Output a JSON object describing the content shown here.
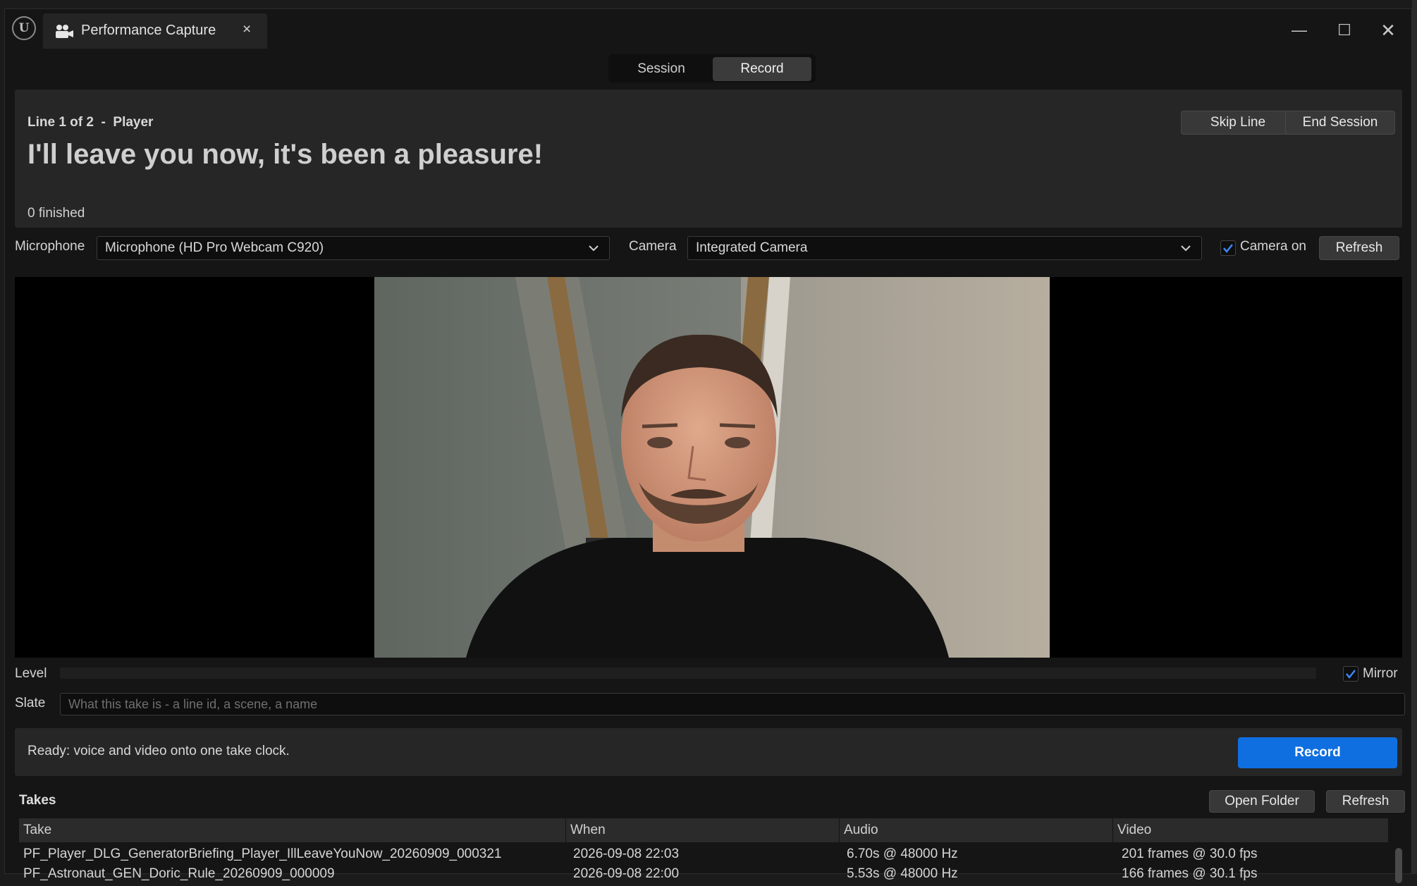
{
  "window": {
    "tab_title": "Performance Capture",
    "tab_close": "×",
    "min": "—",
    "max": "☐",
    "close": "✕"
  },
  "mode_tabs": {
    "session": "Session",
    "record": "Record",
    "active": "Record"
  },
  "line_panel": {
    "header": "Line 1 of 2  -  Player",
    "text": "I'll leave you now, it's been a pleasure!",
    "finished": "0 finished",
    "skip_label": "Skip Line",
    "end_label": "End Session"
  },
  "devices": {
    "microphone_label": "Microphone",
    "microphone_value": "Microphone (HD Pro Webcam C920)",
    "camera_label": "Camera",
    "camera_value": "Integrated Camera",
    "camera_on_label": "Camera on",
    "camera_on_checked": true,
    "refresh_label": "Refresh"
  },
  "level": {
    "label": "Level",
    "mirror_label": "Mirror",
    "mirror_checked": true
  },
  "slate": {
    "label": "Slate",
    "placeholder": "What this take is - a line id, a scene, a name"
  },
  "status": {
    "text": "Ready: voice and video onto one take clock.",
    "record_label": "Record"
  },
  "takes": {
    "title": "Takes",
    "open_folder_label": "Open Folder",
    "refresh_label": "Refresh",
    "columns": [
      "Take",
      "When",
      "Audio",
      "Video"
    ],
    "rows": [
      [
        "PF_Player_DLG_GeneratorBriefing_Player_IllLeaveYouNow_20260909_000321",
        "2026-09-08 22:03",
        "6.70s @ 48000 Hz",
        "201 frames @ 30.0 fps"
      ],
      [
        "PF_Astronaut_GEN_Doric_Rule_20260909_000009",
        "2026-09-08 22:00",
        "5.53s @ 48000 Hz",
        "166 frames @ 30.1 fps"
      ]
    ]
  },
  "colors": {
    "accent": "#0f6fe0",
    "panel": "#262626",
    "background": "#151515"
  }
}
